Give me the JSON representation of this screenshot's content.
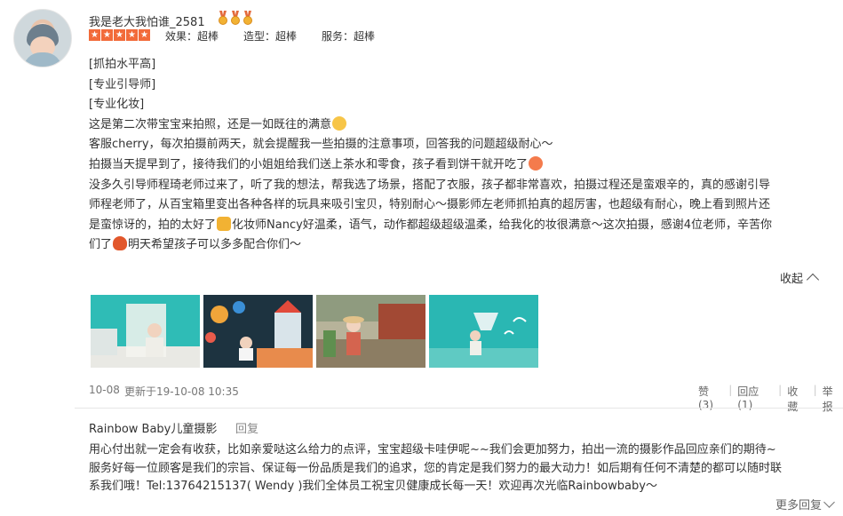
{
  "user": {
    "name": "我是老大我怕谁_2581",
    "rating_stars": 5,
    "scores": [
      {
        "label": "效果：超棒"
      },
      {
        "label": "造型：超棒"
      },
      {
        "label": "服务：超棒"
      }
    ]
  },
  "review": {
    "lines": [
      "[抓拍水平高]",
      "[专业引导师]",
      "[专业化妆]",
      "这是第二次带宝宝来拍照，还是一如既往的满意",
      "客服cherry，每次拍摄前两天，就会提醒我一些拍摄的注意事项，回答我的问题超级耐心～",
      "拍摄当天提早到了，接待我们的小姐姐给我们送上茶水和零食，孩子看到饼干就开吃了",
      "没多久引导师程琦老师过来了，听了我的想法，帮我选了场景，搭配了衣服，孩子都非常喜欢，拍摄过程还是蛮艰辛的，真的感谢引导",
      "师程老师了，从百宝箱里变出各种各样的玩具来吸引宝贝，特别耐心～摄影师左老师抓拍真的超厉害，也超级有耐心，晚上看到照片还",
      "是蛮惊讶的，拍的太好了",
      "化妆师Nancy好温柔，语气，动作都超级超级温柔，给我化的妆很满意～这次拍摄，感谢4位老师，辛苦你",
      "们了",
      "明天希望孩子可以多多配合你们～"
    ]
  },
  "collapse_label": "收起",
  "photos": [
    {
      "alt": "photo-1"
    },
    {
      "alt": "photo-2"
    },
    {
      "alt": "photo-3"
    },
    {
      "alt": "photo-4"
    }
  ],
  "meta": {
    "date": "10-08",
    "updated": "更新于19-10-08 10:35"
  },
  "actions": {
    "like": "赞(3)",
    "reply": "回应(1)",
    "favorite": "收藏",
    "report": "举报"
  },
  "merchant_reply": {
    "name": "Rainbow Baby儿童摄影",
    "reply_link": "回复",
    "lines": [
      "用心付出就一定会有收获，比如亲爱哒这么给力的点评，宝宝超级卡哇伊呢~~我们会更加努力，拍出一流的摄影作品回应亲们的期待~",
      "服务好每一位顾客是我们的宗旨、保证每一份品质是我们的追求，您的肯定是我们努力的最大动力！如后期有任何不清楚的都可以随时联",
      "系我们哦！Tel:13764215137( Wendy )我们全体员工祝宝贝健康成长每一天！欢迎再次光临Rainbowbaby～"
    ]
  },
  "more_replies": "更多回复",
  "colors": {
    "star": "#f26b3a",
    "photo_teal": "#2ab7b3"
  }
}
